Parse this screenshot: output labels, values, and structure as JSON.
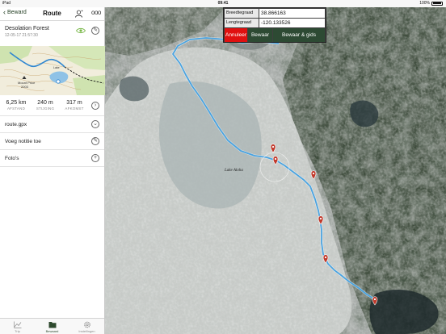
{
  "status": {
    "device": "iPad",
    "time": "09:41",
    "battery": "100%"
  },
  "nav": {
    "back_label": "Beward",
    "title": "Route"
  },
  "track": {
    "name": "Desolation Forest",
    "date": "12-05-17 21:57:30"
  },
  "thumbnail": {
    "peak_label": "Mount Price",
    "peak_elev": "2003",
    "lake_label": "Lake"
  },
  "stats": {
    "distance": {
      "value": "6,25 km",
      "label": "AFSTAND"
    },
    "ascent": {
      "value": "240 m",
      "label": "STIJGING"
    },
    "descent": {
      "value": "317 m",
      "label": "AFKOMST"
    }
  },
  "rows": {
    "file": "route.gpx",
    "note": "Voeg notitie toe",
    "photos": "Foto's"
  },
  "tabs": {
    "trip": "Trip",
    "saved": "Bewaard",
    "settings": "Instellingen"
  },
  "coords": {
    "lat_label": "Breedtegraad",
    "lat_value": "38.866163",
    "lon_label": "Lengtegraad",
    "lon_value": "-120.133526",
    "cancel": "Annuleer",
    "save": "Bewaar",
    "save_guide": "Bewaar & gids"
  },
  "map": {
    "lake_label": "Lake Aloha"
  },
  "colors": {
    "route": "#4aa3e0",
    "marker": "#c0392b",
    "cancel": "#e01010",
    "button": "#2d4a33"
  }
}
